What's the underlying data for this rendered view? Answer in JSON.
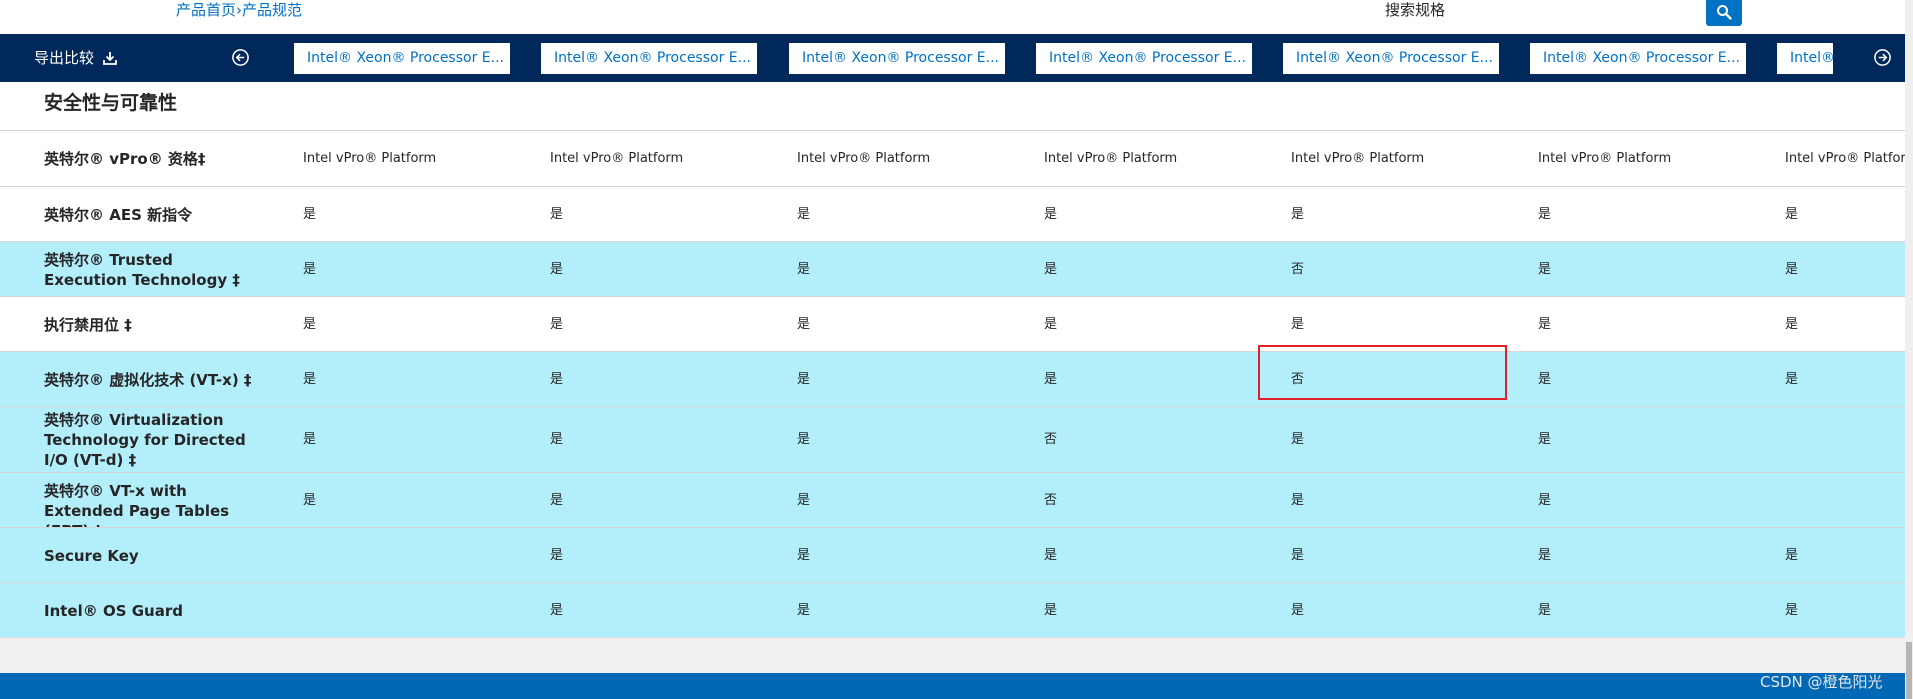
{
  "breadcrumb": {
    "home": "产品首页",
    "sep": "›",
    "current": "产品规范"
  },
  "search": {
    "placeholder": "搜索规格",
    "icon": "search-icon"
  },
  "compare_bar": {
    "export_label": "导出比较",
    "processors": [
      "Intel® Xeon® Processor E...",
      "Intel® Xeon® Processor E...",
      "Intel® Xeon® Processor E...",
      "Intel® Xeon® Processor E...",
      "Intel® Xeon® Processor E...",
      "Intel® Xeon® Processor E...",
      "Intel®"
    ]
  },
  "section": {
    "title": "安全性与可靠性"
  },
  "rows": [
    {
      "label": "英特尔® vPro® 资格‡",
      "values": [
        "Intel vPro® Platform",
        "Intel vPro® Platform",
        "Intel vPro® Platform",
        "Intel vPro® Platform",
        "Intel vPro® Platform",
        "Intel vPro® Platform",
        "Intel vPro® Platform"
      ]
    },
    {
      "label": "英特尔® AES 新指令",
      "values": [
        "是",
        "是",
        "是",
        "是",
        "是",
        "是",
        "是"
      ]
    },
    {
      "label": "英特尔® Trusted Execution Technology ‡",
      "values": [
        "是",
        "是",
        "是",
        "是",
        "否",
        "是",
        "是"
      ]
    },
    {
      "label": "执行禁用位 ‡",
      "values": [
        "是",
        "是",
        "是",
        "是",
        "是",
        "是",
        "是"
      ]
    },
    {
      "label": "英特尔® 虚拟化技术 (VT-x) ‡",
      "values": [
        "是",
        "是",
        "是",
        "是",
        "否",
        "是",
        "是"
      ]
    },
    {
      "label": "英特尔® Virtualization Technology for Directed I/O (VT-d) ‡",
      "values": [
        "是",
        "是",
        "是",
        "否",
        "是",
        "是",
        ""
      ]
    },
    {
      "label": "英特尔® VT-x with Extended Page Tables (EPT) ‡",
      "values": [
        "是",
        "是",
        "是",
        "否",
        "是",
        "是",
        ""
      ]
    },
    {
      "label": "Secure Key",
      "values": [
        "",
        "是",
        "是",
        "是",
        "是",
        "是",
        "是"
      ]
    },
    {
      "label": "Intel® OS Guard",
      "values": [
        "",
        "是",
        "是",
        "是",
        "是",
        "是",
        "是"
      ]
    }
  ],
  "watermark": "CSDN @橙色阳光",
  "colors": {
    "nav_bg": "#00285a",
    "accent": "#0071c5",
    "row_highlight": "#b3eefb",
    "annotation_box": "#e0202a"
  }
}
